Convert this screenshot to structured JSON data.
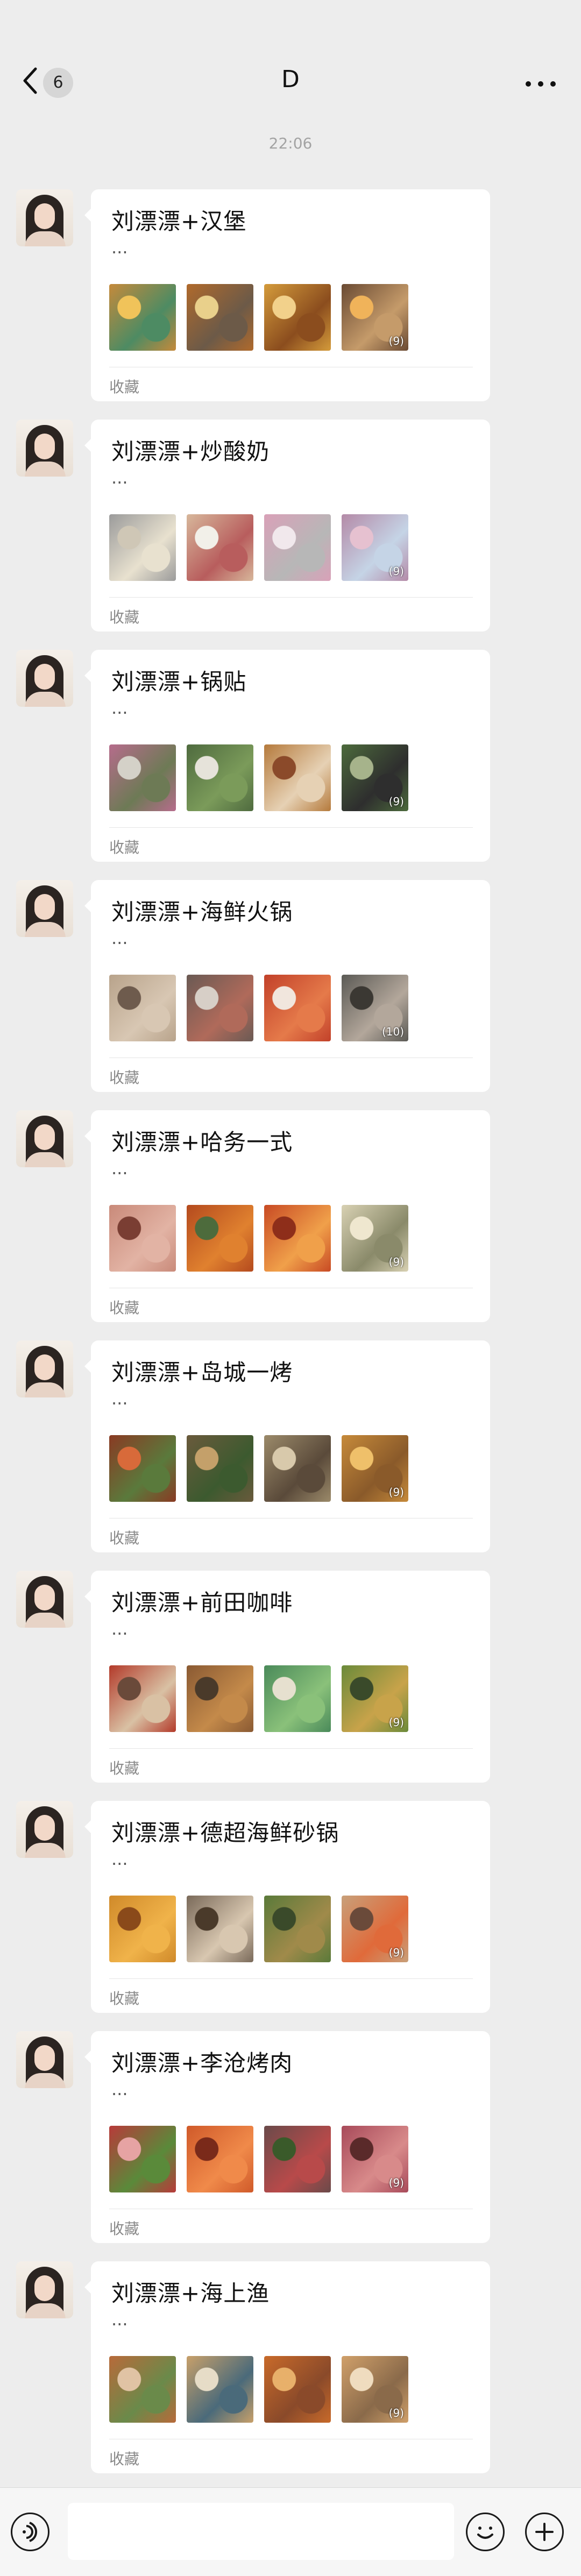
{
  "header": {
    "back_badge": "6",
    "title": "D",
    "more_icon": "ellipsis-icon"
  },
  "timestamp": "22:06",
  "messages": [
    {
      "title": "刘漂漂+汉堡",
      "desc": "...",
      "thumbs": [
        {
          "c1": "#c58a3b",
          "c2": "#4d8b63",
          "c3": "#f0c35a"
        },
        {
          "c1": "#b06a2c",
          "c2": "#6c5a48",
          "c3": "#e9d08b"
        },
        {
          "c1": "#d49b3b",
          "c2": "#8b4d1e",
          "c3": "#f2d18b"
        },
        {
          "c1": "#6a4a33",
          "c2": "#c59b6a",
          "c3": "#f0b35a",
          "count": "(9)"
        }
      ],
      "source": "收藏"
    },
    {
      "title": "刘漂漂+炒酸奶",
      "desc": "...",
      "thumbs": [
        {
          "c1": "#9b9b9b",
          "c2": "#e8e1cf",
          "c3": "#cfc7b6"
        },
        {
          "c1": "#d7b79b",
          "c2": "#b85d5d",
          "c3": "#f2f0e9"
        },
        {
          "c1": "#d9a1b8",
          "c2": "#b7b7b7",
          "c3": "#f1e8ec"
        },
        {
          "c1": "#b48aa7",
          "c2": "#c5d4e6",
          "c3": "#e6c1d0",
          "count": "(9)"
        }
      ],
      "source": "收藏"
    },
    {
      "title": "刘漂漂+锅贴",
      "desc": "...",
      "thumbs": [
        {
          "c1": "#b66c8c",
          "c2": "#6d7a55",
          "c3": "#d4d1c8"
        },
        {
          "c1": "#4f6b3f",
          "c2": "#7b9b5a",
          "c3": "#e6e3da"
        },
        {
          "c1": "#b57a3c",
          "c2": "#e6d1b4",
          "c3": "#8b4a2a"
        },
        {
          "c1": "#4c6a3c",
          "c2": "#2e2e2e",
          "c3": "#a6b38b",
          "count": "(9)"
        }
      ],
      "source": "收藏"
    },
    {
      "title": "刘漂漂+海鲜火锅",
      "desc": "...",
      "thumbs": [
        {
          "c1": "#b8a38b",
          "c2": "#d8c7b3",
          "c3": "#6e5b4d"
        },
        {
          "c1": "#6a5a54",
          "c2": "#b06a5a",
          "c3": "#d7cfc7"
        },
        {
          "c1": "#c2412a",
          "c2": "#e57a4a",
          "c3": "#f1e6dd"
        },
        {
          "c1": "#5b5a55",
          "c2": "#b3a79b",
          "c3": "#3b3833",
          "count": "(10)"
        }
      ],
      "source": "收藏"
    },
    {
      "title": "刘漂漂+哈务一式",
      "desc": "...",
      "thumbs": [
        {
          "c1": "#c98a7a",
          "c2": "#e2b3a4",
          "c3": "#7a3e33"
        },
        {
          "c1": "#b44a1e",
          "c2": "#e0812f",
          "c3": "#4d6b3c"
        },
        {
          "c1": "#c84a24",
          "c2": "#f0a04a",
          "c3": "#8e2e1a"
        },
        {
          "c1": "#d8d1b3",
          "c2": "#8a8a6a",
          "c3": "#efe7cf",
          "count": "(9)"
        }
      ],
      "source": "收藏"
    },
    {
      "title": "刘漂漂+岛城一烤",
      "desc": "...",
      "thumbs": [
        {
          "c1": "#8a3a23",
          "c2": "#5a7a3c",
          "c3": "#d86a3a"
        },
        {
          "c1": "#6a5a3c",
          "c2": "#3c5a2f",
          "c3": "#c4a06a"
        },
        {
          "c1": "#9b8a6a",
          "c2": "#5a4a3a",
          "c3": "#d8c9ab"
        },
        {
          "c1": "#c68a3a",
          "c2": "#8a5a2a",
          "c3": "#efc06a",
          "count": "(9)"
        }
      ],
      "source": "收藏"
    },
    {
      "title": "刘漂漂+前田咖啡",
      "desc": "...",
      "thumbs": [
        {
          "c1": "#b33a2a",
          "c2": "#d9c1a4",
          "c3": "#6a4a3a"
        },
        {
          "c1": "#8a5a33",
          "c2": "#c48a4a",
          "c3": "#4a3a2a"
        },
        {
          "c1": "#4a8a5a",
          "c2": "#8ac17a",
          "c3": "#e6e0cf"
        },
        {
          "c1": "#6a8a3a",
          "c2": "#c8a34a",
          "c3": "#3a4a2a",
          "count": "(9)"
        }
      ],
      "source": "收藏"
    },
    {
      "title": "刘漂漂+德超海鲜砂锅",
      "desc": "...",
      "thumbs": [
        {
          "c1": "#d08a2a",
          "c2": "#f0b34a",
          "c3": "#8a4a1a"
        },
        {
          "c1": "#7a6a5a",
          "c2": "#d8c7b0",
          "c3": "#4a3a2a"
        },
        {
          "c1": "#5a7a3a",
          "c2": "#a08a4a",
          "c3": "#3a4a2a"
        },
        {
          "c1": "#c8a07a",
          "c2": "#e06a3a",
          "c3": "#6a4a3a",
          "count": "(9)"
        }
      ],
      "source": "收藏"
    },
    {
      "title": "刘漂漂+李沧烤肉",
      "desc": "...",
      "thumbs": [
        {
          "c1": "#b83a3a",
          "c2": "#5a8a3a",
          "c3": "#e6a3a3"
        },
        {
          "c1": "#d05a2a",
          "c2": "#f08a4a",
          "c3": "#7a2a1a"
        },
        {
          "c1": "#6a4a4a",
          "c2": "#b84a4a",
          "c3": "#3a5a2a"
        },
        {
          "c1": "#a84a5a",
          "c2": "#d88a8a",
          "c3": "#5a2a2a",
          "count": "(9)"
        }
      ],
      "source": "收藏"
    },
    {
      "title": "刘漂漂+海上渔",
      "desc": "...",
      "thumbs": [
        {
          "c1": "#b86a3a",
          "c2": "#6a8a4a",
          "c3": "#e0c3a4"
        },
        {
          "c1": "#c8a06a",
          "c2": "#4a6a7a",
          "c3": "#e6dcc7"
        },
        {
          "c1": "#c86a2a",
          "c2": "#8a4a2a",
          "c3": "#e8b06a"
        },
        {
          "c1": "#d0a06a",
          "c2": "#8a6a4a",
          "c3": "#efdcbf",
          "count": "(9)"
        }
      ],
      "source": "收藏"
    }
  ],
  "bottom": {
    "voice_icon": "voice-icon",
    "emoji_icon": "emoji-icon",
    "plus_icon": "plus-icon",
    "input_placeholder": ""
  }
}
